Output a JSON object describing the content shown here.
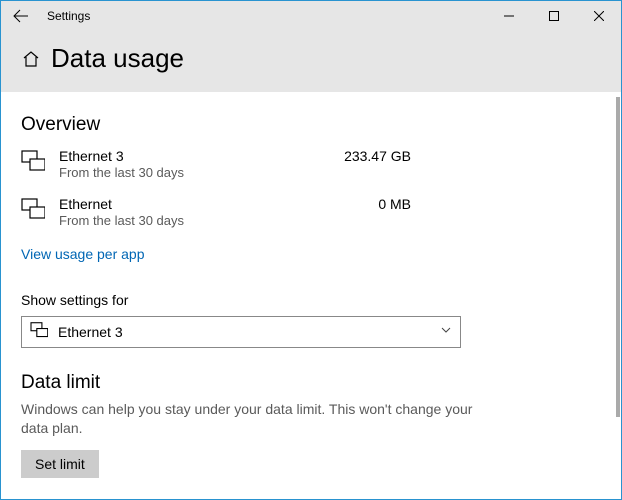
{
  "window": {
    "title": "Settings"
  },
  "page": {
    "title": "Data usage"
  },
  "overview": {
    "heading": "Overview",
    "items": [
      {
        "name": "Ethernet 3",
        "sub": "From the last 30 days",
        "value": "233.47 GB"
      },
      {
        "name": "Ethernet",
        "sub": "From the last 30 days",
        "value": "0 MB"
      }
    ],
    "link": "View usage per app"
  },
  "settingsFor": {
    "label": "Show settings for",
    "selected": "Ethernet 3"
  },
  "dataLimit": {
    "heading": "Data limit",
    "desc": "Windows can help you stay under your data limit. This won't change your data plan.",
    "button": "Set limit"
  }
}
